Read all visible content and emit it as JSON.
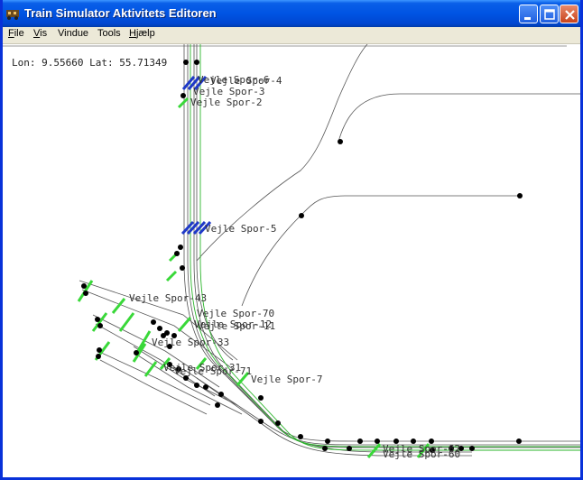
{
  "window": {
    "title": "Train Simulator Aktivitets Editoren"
  },
  "menu": [
    {
      "label": "File",
      "accel": "F",
      "rest": "ile"
    },
    {
      "label": "Vis",
      "accel": "V",
      "rest": "is"
    },
    {
      "label": "Vindue",
      "accel": "",
      "rest": "Vindue"
    },
    {
      "label": "Tools",
      "accel": "",
      "rest": "Tools"
    },
    {
      "label": "Hjælp",
      "accel": "H",
      "rest": "jælp"
    }
  ],
  "status": {
    "coords": "Lon: 9.55660 Lat: 55.71349"
  },
  "platforms": [
    "Vejle Spor-6",
    "Vejle Spor-4",
    "Vejle Spor-3",
    "Vejle Spor-2",
    "Vejle Spor-5",
    "Vejle Spor-43",
    "Vejle Spor-70",
    "Vejle Spor-12",
    "Vejle Spor-11",
    "Vejle Spor-33",
    "Vejle Spor-31",
    "Vejle Spor-71",
    "Vejle Spor-7",
    "Vejle Spor-62",
    "Vejle Spor-60"
  ],
  "colors": {
    "titlebar": "#0054e3",
    "track": "#555555",
    "track_alt": "#2bb52b",
    "platform": "#39d839",
    "platform_blue": "#1f39c8",
    "node": "#000000"
  }
}
